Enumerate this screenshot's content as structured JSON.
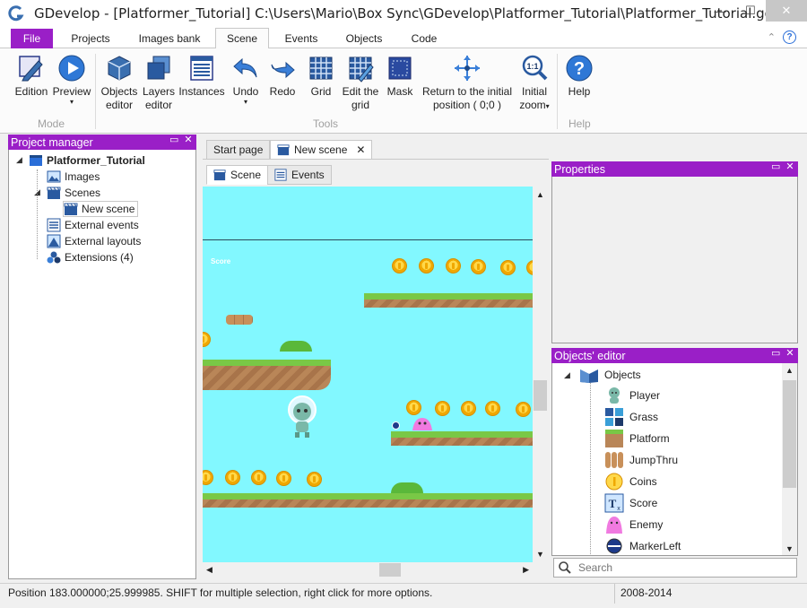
{
  "window": {
    "title": "GDevelop - [Platformer_Tutorial] C:\\Users\\Mario\\Box Sync\\GDevelop\\Platformer_Tutorial\\Platformer_Tutorial.gdg",
    "minimize": "—",
    "maximize": "☐",
    "close": "✕"
  },
  "ribbon_tabs": [
    "File",
    "Projects",
    "Images bank",
    "Scene",
    "Events",
    "Objects",
    "Code"
  ],
  "ribbon_right": {
    "collapse": "⌃",
    "help": "?"
  },
  "ribbon": {
    "mode_group": "Mode",
    "tools_group": "Tools",
    "help_group": "Help",
    "edition": "Edition",
    "preview": "Preview",
    "objects_editor_1": "Objects",
    "objects_editor_2": "editor",
    "layers_editor_1": "Layers",
    "layers_editor_2": "editor",
    "instances": "Instances",
    "undo": "Undo",
    "redo": "Redo",
    "grid": "Grid",
    "edit_grid_1": "Edit the",
    "edit_grid_2": "grid",
    "mask": "Mask",
    "return_1": "Return to the initial",
    "return_2": "position ( 0;0 )",
    "initial_zoom_1": "Initial",
    "initial_zoom_2": "zoom",
    "help": "Help",
    "dropdown_glyph": "▾"
  },
  "project_manager": {
    "title": "Project manager",
    "project": "Platformer_Tutorial",
    "items": {
      "images": "Images",
      "scenes": "Scenes",
      "new_scene": "New scene",
      "external_events": "External events",
      "external_layouts": "External layouts",
      "extensions": "Extensions (4)"
    }
  },
  "panel_buttons": {
    "float": "▭",
    "close": "✕"
  },
  "doc_tabs": {
    "start_page": "Start page",
    "new_scene": "New scene",
    "close": "✕"
  },
  "scene_tabs": {
    "scene": "Scene",
    "events": "Events"
  },
  "scene": {
    "score_label": "Score"
  },
  "properties": {
    "title": "Properties"
  },
  "objects_editor": {
    "title": "Objects' editor",
    "root": "Objects",
    "objects": [
      "Player",
      "Grass",
      "Platform",
      "JumpThru",
      "Coins",
      "Score",
      "Enemy",
      "MarkerLeft"
    ]
  },
  "search": {
    "placeholder": "Search"
  },
  "status": {
    "message": "Position 183.000000;25.999985. SHIFT for multiple selection, right click for more options.",
    "copyright": "2008-2014"
  },
  "colors": {
    "accent": "#9a1fc7",
    "scene_bg": "#82f8ff",
    "grass": "#79c846",
    "dirt": "#b98658"
  }
}
